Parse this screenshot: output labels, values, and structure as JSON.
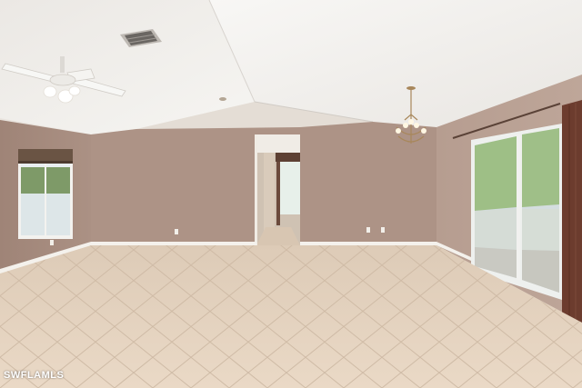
{
  "watermark": {
    "text": "SWFLAMLS"
  },
  "colors": {
    "wall_left": "#a58a7c",
    "wall_back": "#ad9386",
    "wall_right": "#b59c8e",
    "ceiling": "#f1efec",
    "floor_tile": "#e5d2bd",
    "grout": "#d4c0ab",
    "baseboard": "#f4f1ec",
    "window_frame": "#f4f4f2",
    "curtain": "#6c3c2e"
  },
  "icons": [
    "ceiling-fan-icon",
    "chandelier-icon",
    "air-vent-icon",
    "smoke-detector-icon",
    "outlet-icon"
  ]
}
